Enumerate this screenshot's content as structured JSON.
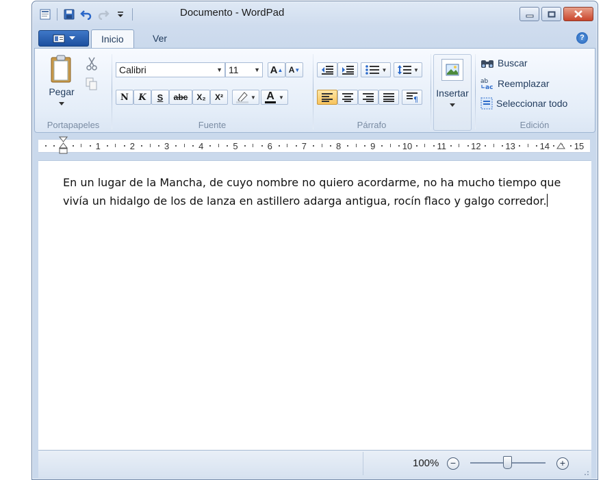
{
  "window": {
    "title": "Documento - WordPad"
  },
  "quick_access": {
    "icons": [
      "wordpad-app-icon",
      "save-icon",
      "undo-icon",
      "redo-icon",
      "customize-qat-icon"
    ]
  },
  "tabs": [
    {
      "label": "Inicio",
      "active": true
    },
    {
      "label": "Ver",
      "active": false
    }
  ],
  "ribbon": {
    "clipboard": {
      "label": "Portapapeles",
      "paste": "Pegar"
    },
    "font": {
      "label": "Fuente",
      "family": "Calibri",
      "size": "11",
      "bold": "N",
      "italic": "K",
      "underline": "S",
      "strike": "abc",
      "sub": "X₂",
      "sup": "X²",
      "grow": "A",
      "shrink": "A",
      "color": "A"
    },
    "paragraph": {
      "label": "Párrafo"
    },
    "insert": {
      "label": "Insertar"
    },
    "edit": {
      "label": "Edición",
      "find": "Buscar",
      "replace": "Reemplazar",
      "select_all": "Seleccionar todo"
    }
  },
  "ruler": {
    "numbers": [
      "1",
      "2",
      "3",
      "4",
      "5",
      "6",
      "7",
      "8",
      "9",
      "10",
      "11",
      "12",
      "13",
      "14",
      "15"
    ]
  },
  "document": {
    "line1": "En un lugar de la Mancha, de cuyo nombre no quiero acordarme, no ha mucho tiempo que",
    "line2": "vivía un hidalgo de los de lanza en astillero adarga antigua, rocín flaco y galgo corredor."
  },
  "status": {
    "zoom": "100%",
    "zoom_out": "−",
    "zoom_in": "+",
    "zoom_level": 0.5
  },
  "colors": {
    "accent": "#1c4f9e",
    "selected": "#f7c35d",
    "close": "#c9452c"
  }
}
